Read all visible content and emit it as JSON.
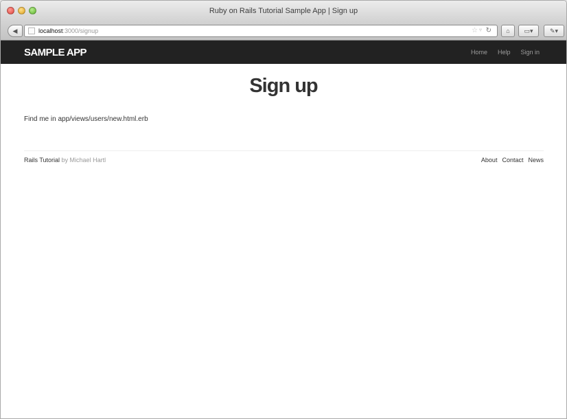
{
  "window": {
    "title": "Ruby on Rails Tutorial Sample App | Sign up"
  },
  "toolbar": {
    "url_host": "localhost",
    "url_path": ":3000/signup",
    "icons": [
      "back-arrow-icon",
      "favicon-icon",
      "star-icon",
      "reload-icon",
      "home-icon",
      "bookmark-icon",
      "extension-icon"
    ]
  },
  "navbar": {
    "brand": "SAMPLE APP",
    "links": [
      "Home",
      "Help",
      "Sign in"
    ]
  },
  "main": {
    "heading": "Sign up",
    "text": "Find me in app/views/users/new.html.erb"
  },
  "footer": {
    "left_link": "Rails Tutorial",
    "left_by": "by Michael Hartl",
    "links": [
      "About",
      "Contact",
      "News"
    ]
  },
  "colors": {
    "navbar_bg": "#222222",
    "nav_link": "#9d9d9d",
    "heading": "#333333"
  }
}
